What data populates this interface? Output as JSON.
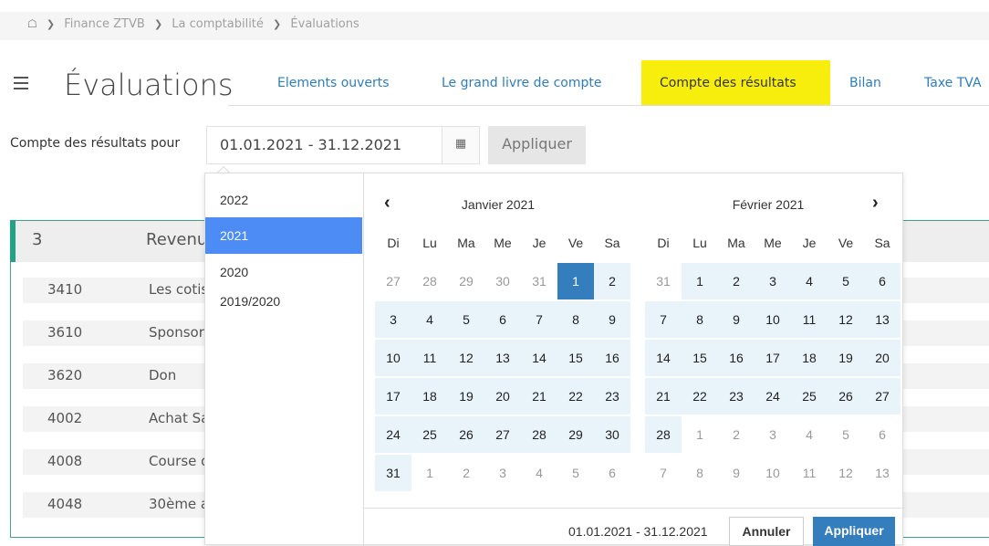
{
  "breadcrumb": {
    "items": [
      "Finance ZTVB",
      "La comptabilité",
      "Évaluations"
    ],
    "home_icon": "home-icon"
  },
  "header": {
    "title": "Évaluations",
    "menu_icon": "hamburger-icon"
  },
  "tabs": [
    {
      "label": "Elements ouverts",
      "active": false
    },
    {
      "label": "Le grand livre de compte",
      "active": false
    },
    {
      "label": "Compte des résultats",
      "active": true
    },
    {
      "label": "Bilan",
      "active": false
    },
    {
      "label": "Taxe TVA",
      "active": false
    }
  ],
  "filter": {
    "label": "Compte des résultats pour",
    "date_range": "01.01.2021 - 31.12.2021",
    "calendar_icon": "calendar-icon",
    "apply_label": "Appliquer"
  },
  "accounts": {
    "group_number": "3",
    "group_title": "Revenus",
    "rows": [
      {
        "code": "3410",
        "label": "Les cotisations"
      },
      {
        "code": "3610",
        "label": "Sponsoring"
      },
      {
        "code": "3620",
        "label": "Don"
      },
      {
        "code": "4002",
        "label": "Achat Sa"
      },
      {
        "code": "4008",
        "label": "Course d"
      },
      {
        "code": "4048",
        "label": "30ème a"
      }
    ]
  },
  "datepicker": {
    "ranges": [
      "2022",
      "2021",
      "2020",
      "2019/2020"
    ],
    "selected_range": "2021",
    "weekdays": [
      "Di",
      "Lu",
      "Ma",
      "Me",
      "Je",
      "Ve",
      "Sa"
    ],
    "months": [
      {
        "title": "Janvier 2021",
        "days": [
          27,
          28,
          29,
          30,
          31,
          1,
          2,
          3,
          4,
          5,
          6,
          7,
          8,
          9,
          10,
          11,
          12,
          13,
          14,
          15,
          16,
          17,
          18,
          19,
          20,
          21,
          22,
          23,
          24,
          25,
          26,
          27,
          28,
          29,
          30,
          31,
          1,
          2,
          3,
          4,
          5,
          6
        ],
        "first_in": 5,
        "last_in": 35
      },
      {
        "title": "Février 2021",
        "days": [
          31,
          1,
          2,
          3,
          4,
          5,
          6,
          7,
          8,
          9,
          10,
          11,
          12,
          13,
          14,
          15,
          16,
          17,
          18,
          19,
          20,
          21,
          22,
          23,
          24,
          25,
          26,
          27,
          28,
          1,
          2,
          3,
          4,
          5,
          6,
          7,
          8,
          9,
          10,
          11,
          12,
          13
        ],
        "first_in": 1,
        "last_in": 28
      }
    ],
    "footer_range": "01.01.2021 - 31.12.2021",
    "cancel_label": "Annuler",
    "apply_label": "Appliquer",
    "prev_icon": "chevron-left-icon",
    "next_icon": "chevron-right-icon"
  }
}
